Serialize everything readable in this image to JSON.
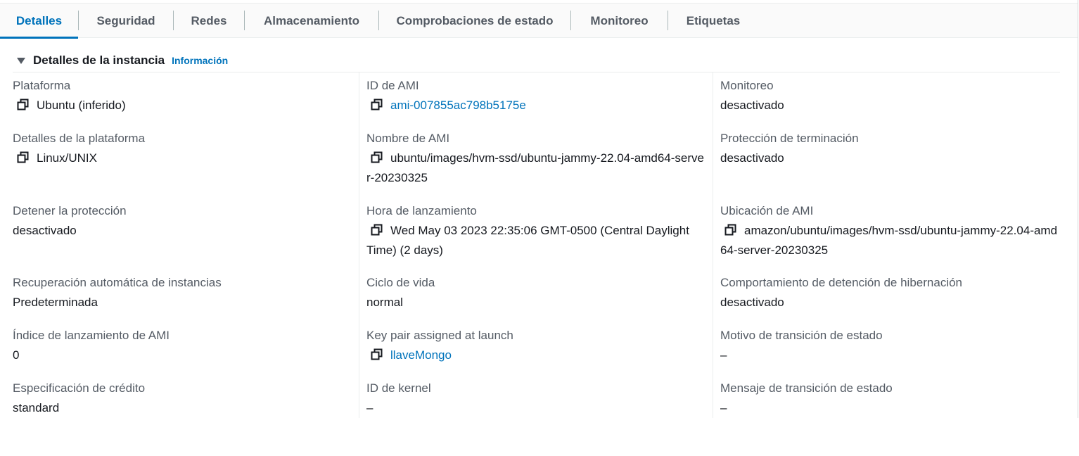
{
  "tabs": [
    {
      "label": "Detalles",
      "active": true
    },
    {
      "label": "Seguridad",
      "active": false
    },
    {
      "label": "Redes",
      "active": false
    },
    {
      "label": "Almacenamiento",
      "active": false
    },
    {
      "label": "Comprobaciones de estado",
      "active": false
    },
    {
      "label": "Monitoreo",
      "active": false
    },
    {
      "label": "Etiquetas",
      "active": false
    }
  ],
  "section": {
    "title": "Detalles de la instancia",
    "info_link": "Información"
  },
  "fields": {
    "platform": {
      "label": "Plataforma",
      "value": "Ubuntu (inferido)"
    },
    "ami_id": {
      "label": "ID de AMI",
      "value": "ami-007855ac798b5175e"
    },
    "monitoring": {
      "label": "Monitoreo",
      "value": "desactivado"
    },
    "platform_details": {
      "label": "Detalles de la plataforma",
      "value": "Linux/UNIX"
    },
    "ami_name": {
      "label": "Nombre de AMI",
      "value": "ubuntu/images/hvm-ssd/ubuntu-jammy-22.04-amd64-server-20230325"
    },
    "termination_protection": {
      "label": "Protección de terminación",
      "value": "desactivado"
    },
    "stop_protection": {
      "label": "Detener la protección",
      "value": "desactivado"
    },
    "launch_time": {
      "label": "Hora de lanzamiento",
      "value": "Wed May 03 2023 22:35:06 GMT-0500 (Central Daylight Time) (2 days)"
    },
    "ami_location": {
      "label": "Ubicación de AMI",
      "value": "amazon/ubuntu/images/hvm-ssd/ubuntu-jammy-22.04-amd64-server-20230325"
    },
    "auto_recovery": {
      "label": "Recuperación automática de instancias",
      "value": "Predeterminada"
    },
    "lifecycle": {
      "label": "Ciclo de vida",
      "value": "normal"
    },
    "hibernation_stop": {
      "label": "Comportamiento de detención de hibernación",
      "value": "desactivado"
    },
    "ami_launch_index": {
      "label": "Índice de lanzamiento de AMI",
      "value": "0"
    },
    "key_pair": {
      "label": "Key pair assigned at launch",
      "value": "llaveMongo"
    },
    "state_transition_reason": {
      "label": "Motivo de transición de estado",
      "value": "–"
    },
    "credit_spec": {
      "label": "Especificación de crédito",
      "value": "standard"
    },
    "kernel_id": {
      "label": "ID de kernel",
      "value": "–"
    },
    "state_transition_message": {
      "label": "Mensaje de transición de estado",
      "value": "–"
    }
  },
  "colors": {
    "accent": "#0073bb",
    "label_gray": "#545b64",
    "text": "#16191f"
  }
}
